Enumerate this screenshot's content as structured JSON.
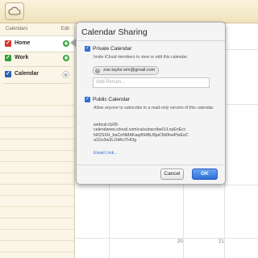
{
  "sidebar": {
    "header_title": "Calendars",
    "edit_label": "Edit",
    "items": [
      {
        "label": "Home",
        "color": "#d9322f",
        "share_color": "#39a33c",
        "share_icon": "broadcast-icon"
      },
      {
        "label": "Work",
        "color": "#2f9e38",
        "share_color": "#39a33c",
        "share_icon": "broadcast-icon"
      },
      {
        "label": "Calendar",
        "color": "#2c5fb6",
        "share_color": "#c4c4c4",
        "share_icon": "broadcast-icon"
      }
    ]
  },
  "calendar": {
    "day_numbers": [
      "20",
      "21"
    ]
  },
  "popover": {
    "title": "Calendar Sharing",
    "private": {
      "label": "Private Calendar",
      "checked": true,
      "description": "Invite iCloud members to view or edit this calendar.",
      "invitee": "zoe.taylor.wm@gmail.com",
      "add_placeholder": "Add Person..."
    },
    "public": {
      "label": "Public Calendar",
      "checked": true,
      "description": "Allow anyone to subscribe to a read-only version of this calendar.",
      "url": "webcal://p05-\ncalendarws.icloud.com/ca/subscribe/1/LnyEnEcc\nhR2SXH_baCnNMAKaqrBHBU9jaCNt0hwPtsEoC\na1Gx3w3LOdKnTHOg",
      "email_link": "Email Link..."
    },
    "cancel_label": "Cancel",
    "ok_label": "OK",
    "accent": "#2d6fd6"
  }
}
